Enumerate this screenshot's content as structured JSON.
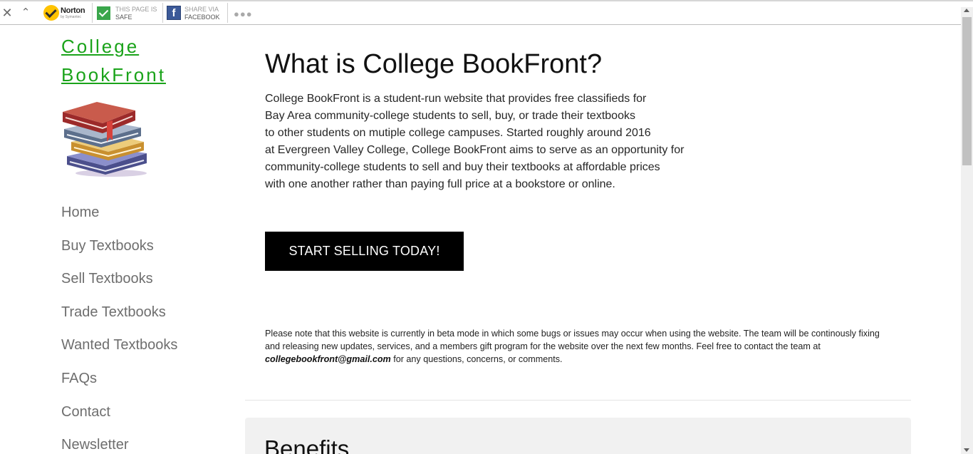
{
  "toolbar": {
    "norton_name": "Norton",
    "norton_sub": "by Symantec",
    "safe_line1": "THIS PAGE IS",
    "safe_line2": "SAFE",
    "share_line1": "SHARE VIA",
    "share_line2": "FACEBOOK",
    "facebook_glyph": "f",
    "close_glyph": "✕",
    "collapse_glyph": "⌃",
    "more_glyph": "●●●"
  },
  "sidebar": {
    "title_line1": "College",
    "title_line2": "BookFront",
    "nav": [
      "Home",
      "Buy Textbooks",
      "Sell Textbooks",
      "Trade Textbooks",
      "Wanted Textbooks",
      "FAQs",
      "Contact",
      "Newsletter"
    ]
  },
  "main": {
    "title": "What is College BookFront?",
    "intro_lines": [
      "College BookFront is a student-run website that provides free classifieds for",
      "Bay Area community-college students to sell, buy, or trade their textbooks",
      "to other students on mutiple college campuses. Started roughly around 2016",
      "at Evergreen Valley College, College BookFront aims to serve as an opportunity for",
      "community-college students to sell and buy their textbooks at affordable prices",
      "with one another rather than paying full price at a bookstore or online."
    ],
    "cta_label": "START SELLING TODAY!",
    "note_before": "Please note that this website is currently in beta mode in which some bugs or issues may occur when using the website. The team will be continously fixing and releasing new updates, services, and a members gift program for the website over the next few months. Feel free to contact the team at ",
    "note_email": "collegebookfront@gmail.com",
    "note_after": " for any questions, concerns, or comments.",
    "benefits_title": "Benefits"
  }
}
